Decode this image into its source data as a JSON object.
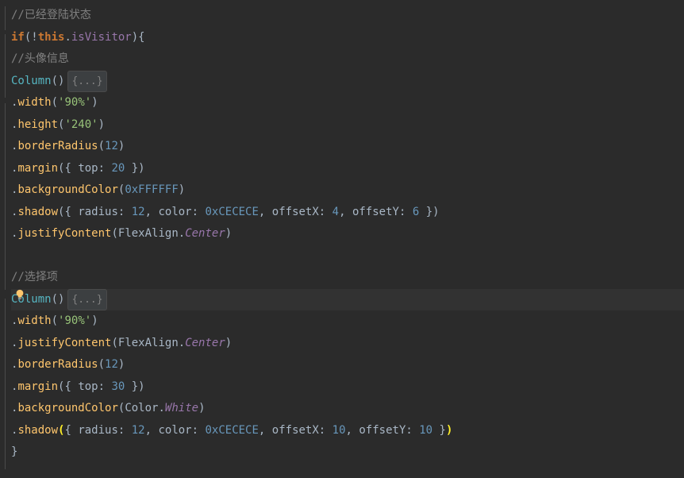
{
  "lines": {
    "l1_comment": "//已经登陆状态",
    "l2_if": "if",
    "l2_this": "this",
    "l2_isVisitor": "isVisitor",
    "l3_comment": "//头像信息",
    "l4_column": "Column",
    "l4_collapsed": "{...}",
    "l5_width": "width",
    "l5_width_val": "'90%'",
    "l6_height": "height",
    "l6_height_val": "'240'",
    "l7_borderRadius": "borderRadius",
    "l7_borderRadius_val": "12",
    "l8_margin": "margin",
    "l8_top": "top",
    "l8_margin_val": "20",
    "l9_bgColor": "backgroundColor",
    "l9_bgColor_val": "0xFFFFFF",
    "l10_shadow": "shadow",
    "l10_radius": "radius",
    "l10_radius_val": "12",
    "l10_color": "color",
    "l10_color_val": "0xCECECE",
    "l10_offsetX": "offsetX",
    "l10_offsetX_val": "4",
    "l10_offsetY": "offsetY",
    "l10_offsetY_val": "6",
    "l11_justify": "justifyContent",
    "l11_flexAlign": "FlexAlign",
    "l11_center": "Center",
    "l13_comment": "//选择项",
    "l14_column": "Column",
    "l14_collapsed": "{...}",
    "l15_width": "width",
    "l15_width_val": "'90%'",
    "l16_justify": "justifyContent",
    "l16_flexAlign": "FlexAlign",
    "l16_center": "Center",
    "l17_borderRadius": "borderRadius",
    "l17_borderRadius_val": "12",
    "l18_margin": "margin",
    "l18_top": "top",
    "l18_margin_val": "30",
    "l19_bgColor": "backgroundColor",
    "l19_color": "Color",
    "l19_white": "White",
    "l20_shadow": "shadow",
    "l20_radius": "radius",
    "l20_radius_val": "12",
    "l20_color": "color",
    "l20_color_val": "0xCECECE",
    "l20_offsetX": "offsetX",
    "l20_offsetX_val": "10",
    "l20_offsetY": "offsetY",
    "l20_offsetY_val": "10"
  }
}
